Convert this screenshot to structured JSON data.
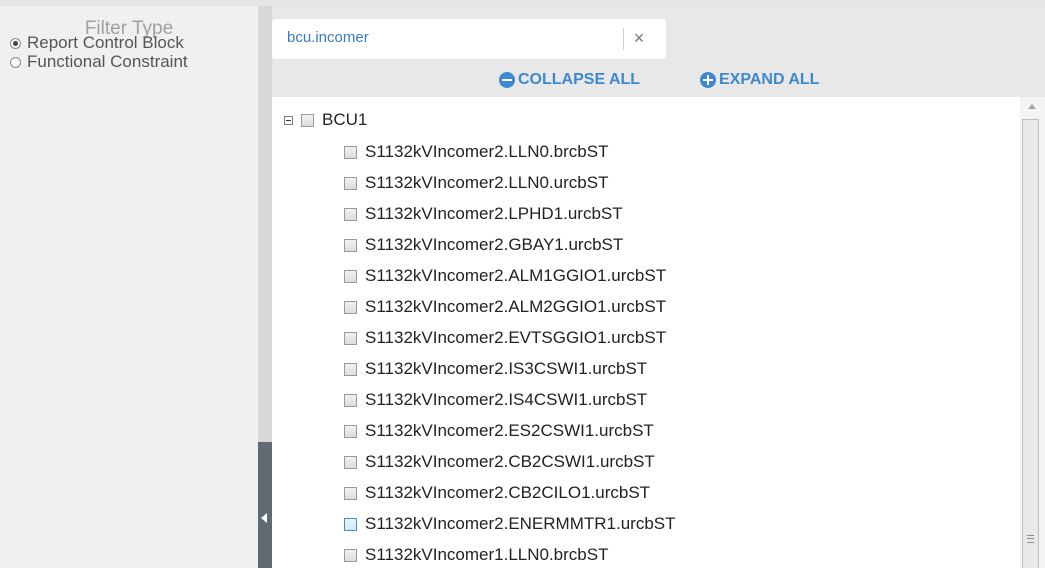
{
  "filter": {
    "title": "Filter Type",
    "options": [
      {
        "label": "Report Control Block",
        "selected": true
      },
      {
        "label": "Functional Constraint",
        "selected": false
      }
    ]
  },
  "search": {
    "value": "bcu.incomer",
    "clear_symbol": "×"
  },
  "toolbar": {
    "collapse_label": "COLLAPSE ALL",
    "expand_label": "EXPAND ALL",
    "accent_color": "#3d88d0"
  },
  "tree": {
    "root_label": "BCU1",
    "items": [
      "S1132kVIncomer2.LLN0.brcbST",
      "S1132kVIncomer2.LLN0.urcbST",
      "S1132kVIncomer2.LPHD1.urcbST",
      "S1132kVIncomer2.GBAY1.urcbST",
      "S1132kVIncomer2.ALM1GGIO1.urcbST",
      "S1132kVIncomer2.ALM2GGIO1.urcbST",
      "S1132kVIncomer2.EVTSGGIO1.urcbST",
      "S1132kVIncomer2.IS3CSWI1.urcbST",
      "S1132kVIncomer2.IS4CSWI1.urcbST",
      "S1132kVIncomer2.ES2CSWI1.urcbST",
      "S1132kVIncomer2.CB2CSWI1.urcbST",
      "S1132kVIncomer2.CB2CILO1.urcbST",
      "S1132kVIncomer2.ENERMMTR1.urcbST",
      "S1132kVIncomer1.LLN0.brcbST"
    ]
  }
}
